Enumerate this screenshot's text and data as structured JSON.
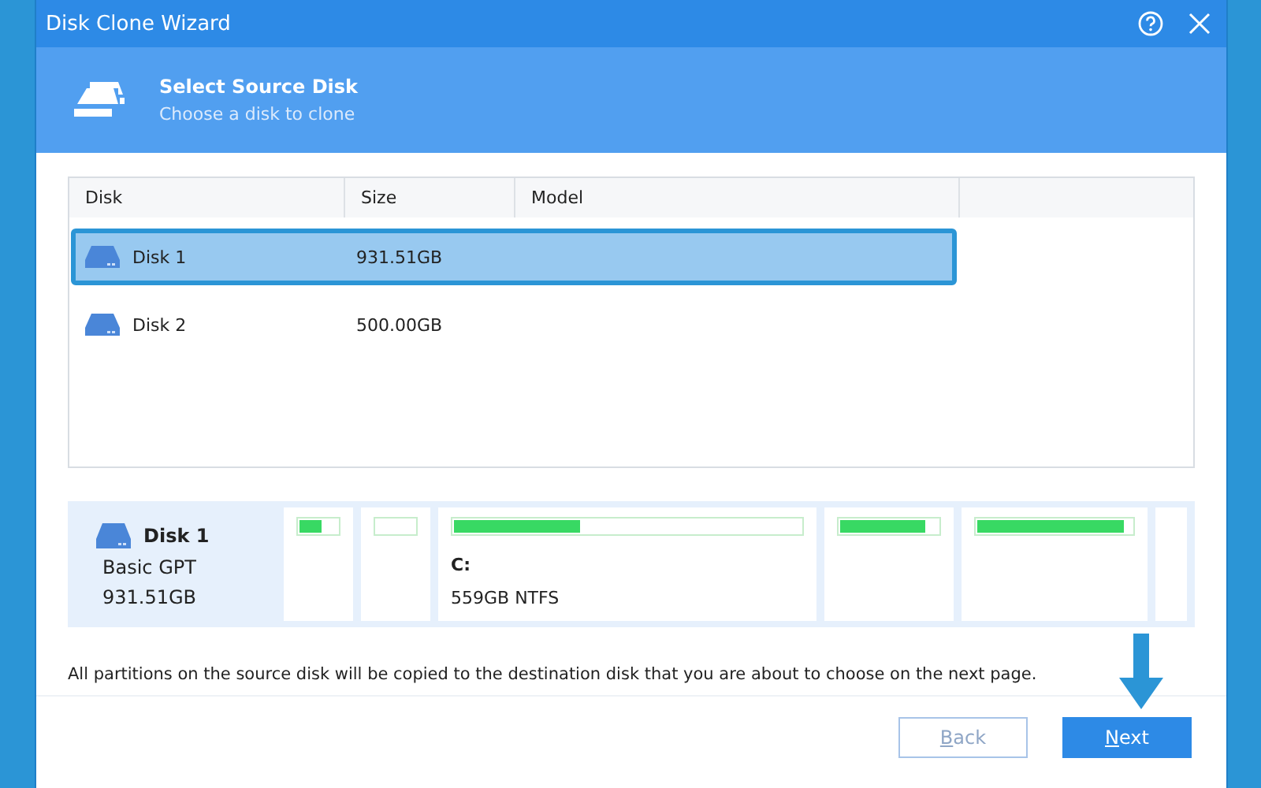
{
  "window": {
    "title": "Disk Clone Wizard"
  },
  "header": {
    "title": "Select Source Disk",
    "subtitle": "Choose a disk to clone"
  },
  "table": {
    "columns": [
      "Disk",
      "Size",
      "Model"
    ],
    "rows": [
      {
        "disk": "Disk 1",
        "size": "931.51GB",
        "selected": true
      },
      {
        "disk": "Disk 2",
        "size": "500.00GB",
        "selected": false
      }
    ]
  },
  "disk_map": {
    "name": "Disk 1",
    "type": "Basic GPT",
    "size": "931.51GB",
    "partitions": [
      {
        "kind": "bar",
        "level": 0.6
      },
      {
        "kind": "bar",
        "level": 0
      },
      {
        "kind": "bar",
        "level": 0.37,
        "label": "C:",
        "detail": "559GB NTFS"
      },
      {
        "kind": "bar",
        "level": 0.88
      },
      {
        "kind": "bar",
        "level": 0.95
      },
      {
        "kind": "empty"
      }
    ]
  },
  "note": "All partitions on the source disk will be copied to the destination disk that you are about to choose on the next page.",
  "buttons": [
    {
      "label": "Back",
      "disabled": true
    },
    {
      "label": "Next",
      "disabled": false
    }
  ]
}
